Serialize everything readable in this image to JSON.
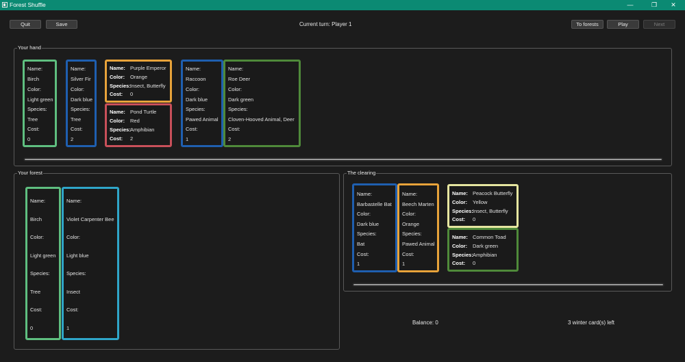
{
  "window": {
    "title": "Forest Shuffle",
    "minimize_glyph": "—",
    "maximize_glyph": "❐",
    "close_glyph": "✕"
  },
  "toolbar": {
    "quit_label": "Quit",
    "save_label": "Save",
    "current_turn": "Current turn: Player 1",
    "to_forests_label": "To forests",
    "play_label": "Play",
    "next_label": "Next"
  },
  "labels": {
    "name": "Name:",
    "color": "Color:",
    "species": "Species:",
    "cost": "Cost:"
  },
  "hand": {
    "title": "Your hand",
    "cards": [
      {
        "name": "Birch",
        "color": "Light green",
        "species": "Tree",
        "cost": "0",
        "border": "#5fbf80"
      },
      {
        "name": "Silver Fir",
        "color": "Dark blue",
        "species": "Tree",
        "cost": "2",
        "border": "#1f5fb0"
      },
      {
        "name": "Purple Emperor",
        "color": "Orange",
        "species": "Insect, Butterfly",
        "cost": "0",
        "border": "#e8a33a"
      },
      {
        "name": "Pond Turtle",
        "color": "Red",
        "species": "Amphibian",
        "cost": "2",
        "border": "#c9505a"
      },
      {
        "name": "Raccoon",
        "color": "Dark blue",
        "species": "Pawed Animal",
        "cost": "1",
        "border": "#1f5fb0"
      },
      {
        "name": "Roe Deer",
        "color": "Dark green",
        "species": "Cloven-Hooved Animal, Deer",
        "cost": "2",
        "border": "#4f8a3a"
      }
    ]
  },
  "forest": {
    "title": "Your forest",
    "cards": [
      {
        "name": "Birch",
        "color": "Light green",
        "species": "Tree",
        "cost": "0",
        "border": "#5fbf80"
      },
      {
        "name": "Violet Carpenter Bee",
        "color": "Light blue",
        "species": "Insect",
        "cost": "1",
        "border": "#2fa6c9"
      }
    ]
  },
  "clearing": {
    "title": "The clearing",
    "cards": [
      {
        "name": "Barbastelle Bat",
        "color": "Dark blue",
        "species": "Bat",
        "cost": "1",
        "border": "#1f5fb0"
      },
      {
        "name": "Beech Marten",
        "color": "Orange",
        "species": "Pawed Animal",
        "cost": "1",
        "border": "#e8a33a"
      },
      {
        "name": "Peacock Butterfly",
        "color": "Yellow",
        "species": "Insect, Butterfly",
        "cost": "0",
        "border": "#e6e6a0"
      },
      {
        "name": "Common Toad",
        "color": "Dark green",
        "species": "Amphibian",
        "cost": "0",
        "border": "#4f8a3a"
      }
    ]
  },
  "status": {
    "balance": "Balance: 0",
    "winter_cards": "3 winter card(s) left"
  }
}
